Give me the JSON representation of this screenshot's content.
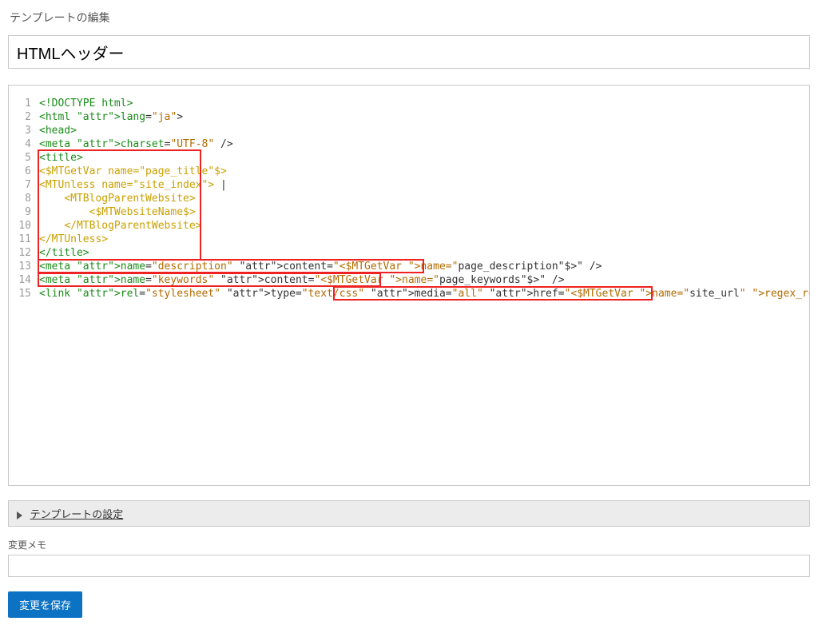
{
  "page": {
    "title": "テンプレートの編集",
    "template_name": "HTMLヘッダー",
    "settings_accordion_label": "テンプレートの設定",
    "memo_label": "変更メモ",
    "memo_value": "",
    "save_button_label": "変更を保存"
  },
  "editor": {
    "line_numbers": [
      "1",
      "2",
      "3",
      "4",
      "5",
      "6",
      "7",
      "8",
      "9",
      "10",
      "11",
      "12",
      "13",
      "14",
      "15"
    ],
    "lines_raw": [
      "<!DOCTYPE html>",
      "<html lang=\"ja\">",
      "<head>",
      "<meta charset=\"UTF-8\" />",
      "<title>",
      "<$MTGetVar name=\"page_title\"$>",
      "<MTUnless name=\"site_index\"> |",
      "    <MTBlogParentWebsite>",
      "        <$MTWebsiteName$>",
      "    </MTBlogParentWebsite>",
      "</MTUnless>",
      "</title>",
      "<meta name=\"description\" content=\"<$MTGetVar name=\"page_description\"$>\" />",
      "<meta name=\"keywords\" content=\"<$MTGetVar name=\"page_keywords\"$>\" />",
      "<link rel=\"stylesheet\" type=\"text/css\" media=\"all\" href=\"<$MTGetVar name=\"site_url\" regex_replace=\"/https?:\\/\\/[^/]+/g\",\"\"$>resources/css/style.css\" />"
    ]
  }
}
